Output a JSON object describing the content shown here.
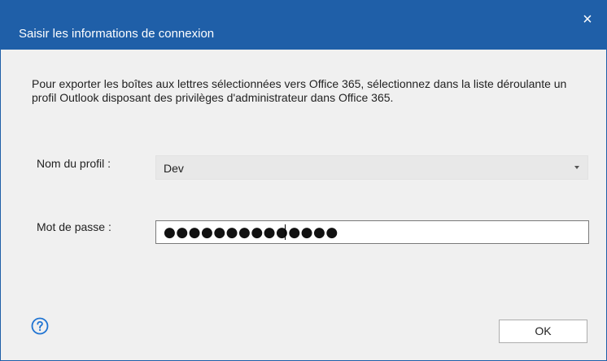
{
  "dialog": {
    "title": "Saisir les informations de connexion",
    "close_glyph": "×",
    "description": "Pour exporter les boîtes aux lettres sélectionnées vers Office 365, sélectionnez dans la liste déroulante un profil Outlook disposant des privilèges d'administrateur dans Office 365."
  },
  "form": {
    "profile_label": "Nom du profil :",
    "profile_value": "Dev",
    "password_label": "Mot de passe :",
    "password_value": "●●●●●●●●●●●●●●"
  },
  "footer": {
    "help_icon": "question-circle-icon",
    "ok_label": "OK"
  },
  "colors": {
    "titlebar": "#1f5fa8",
    "background": "#f0f0f0",
    "help_icon": "#1e73d2"
  }
}
